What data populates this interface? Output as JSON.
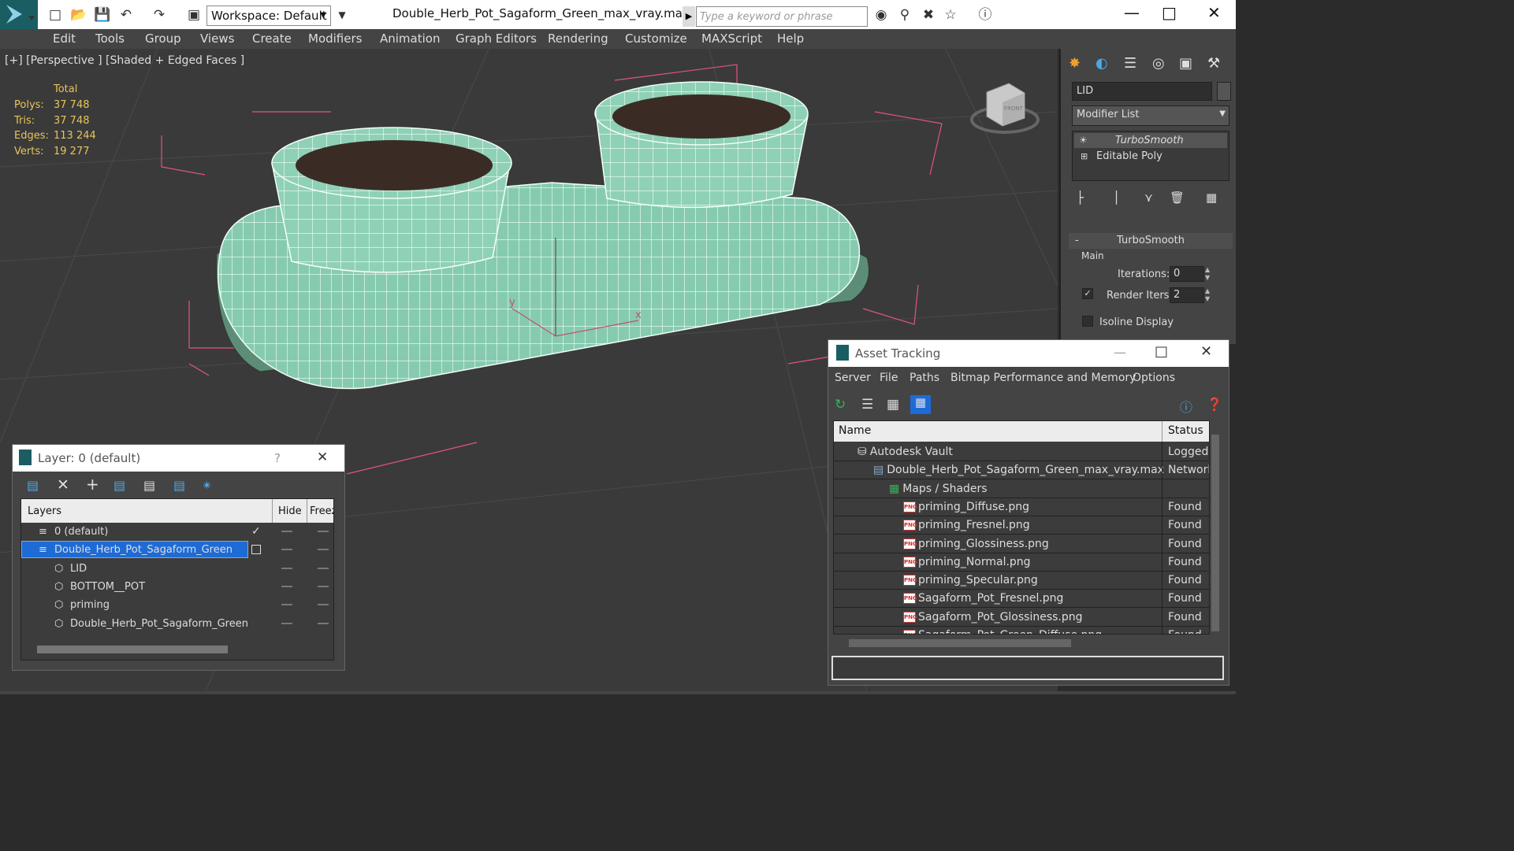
{
  "titlebar": {
    "workspace": "Workspace: Default",
    "title": "Double_Herb_Pot_Sagaform_Green_max_vray.max",
    "search_placeholder": "Type a keyword or phrase"
  },
  "menu": [
    "Edit",
    "Tools",
    "Group",
    "Views",
    "Create",
    "Modifiers",
    "Animation",
    "Graph Editors",
    "Rendering",
    "Customize",
    "MAXScript",
    "Help"
  ],
  "viewport": {
    "label": "[+] [Perspective ] [Shaded + Edged Faces ]",
    "stats": {
      "header": "Total",
      "rows": [
        {
          "k": "Polys:",
          "v": "37 748"
        },
        {
          "k": "Tris:",
          "v": "37 748"
        },
        {
          "k": "Edges:",
          "v": "113 244"
        },
        {
          "k": "Verts:",
          "v": "19 277"
        }
      ]
    },
    "gizmo_x": "x",
    "gizmo_y": "y",
    "viewcube_label": "FRONT"
  },
  "cmdpanel": {
    "object_name": "LID",
    "modifier_list": "Modifier List",
    "stack": [
      "TurboSmooth",
      "Editable Poly"
    ],
    "rollout_title": "TurboSmooth",
    "main_label": "Main",
    "iterations_label": "Iterations:",
    "iterations_value": "0",
    "render_iters_label": "Render Iters:",
    "render_iters_value": "2",
    "isoline_label": "Isoline Display"
  },
  "asset": {
    "title": "Asset Tracking",
    "menu": [
      "Server",
      "File",
      "Paths",
      "Bitmap Performance and Memory",
      "Options"
    ],
    "col_name": "Name",
    "col_status": "Status",
    "rows": [
      {
        "name": "Autodesk Vault",
        "status": "Logged",
        "indent": 30,
        "icon": "vault"
      },
      {
        "name": "Double_Herb_Pot_Sagaform_Green_max_vray.max",
        "status": "Network",
        "indent": 50,
        "icon": "max"
      },
      {
        "name": "Maps / Shaders",
        "status": "",
        "indent": 70,
        "icon": "maps"
      },
      {
        "name": "priming_Diffuse.png",
        "status": "Found",
        "indent": 88,
        "icon": "png"
      },
      {
        "name": "priming_Fresnel.png",
        "status": "Found",
        "indent": 88,
        "icon": "png"
      },
      {
        "name": "priming_Glossiness.png",
        "status": "Found",
        "indent": 88,
        "icon": "png"
      },
      {
        "name": "priming_Normal.png",
        "status": "Found",
        "indent": 88,
        "icon": "png"
      },
      {
        "name": "priming_Specular.png",
        "status": "Found",
        "indent": 88,
        "icon": "png"
      },
      {
        "name": "Sagaform_Pot_Fresnel.png",
        "status": "Found",
        "indent": 88,
        "icon": "png"
      },
      {
        "name": "Sagaform_Pot_Glossiness.png",
        "status": "Found",
        "indent": 88,
        "icon": "png"
      },
      {
        "name": "Sagaform_Pot_Green_Diffuse.png",
        "status": "Found",
        "indent": 88,
        "icon": "png"
      }
    ],
    "png_tag": "PNG"
  },
  "layer": {
    "title": "Layer: 0 (default)",
    "help": "?",
    "col_layers": "Layers",
    "col_hide": "Hide",
    "col_freeze": "Freez",
    "rows": [
      {
        "name": "0 (default)",
        "indent": 22,
        "selected": false
      },
      {
        "name": "Double_Herb_Pot_Sagaform_Green",
        "indent": 22,
        "selected": true
      },
      {
        "name": "LID",
        "indent": 42,
        "selected": false
      },
      {
        "name": "BOTTOM__POT",
        "indent": 42,
        "selected": false
      },
      {
        "name": "priming",
        "indent": 42,
        "selected": false
      },
      {
        "name": "Double_Herb_Pot_Sagaform_Green",
        "indent": 42,
        "selected": false
      }
    ]
  },
  "colors": {
    "mesh": "#8fd1b6",
    "accent_blue": "#1e6bd6",
    "viewport_bg": "#3a3a3a",
    "stat_yellow": "#e8c45a"
  }
}
